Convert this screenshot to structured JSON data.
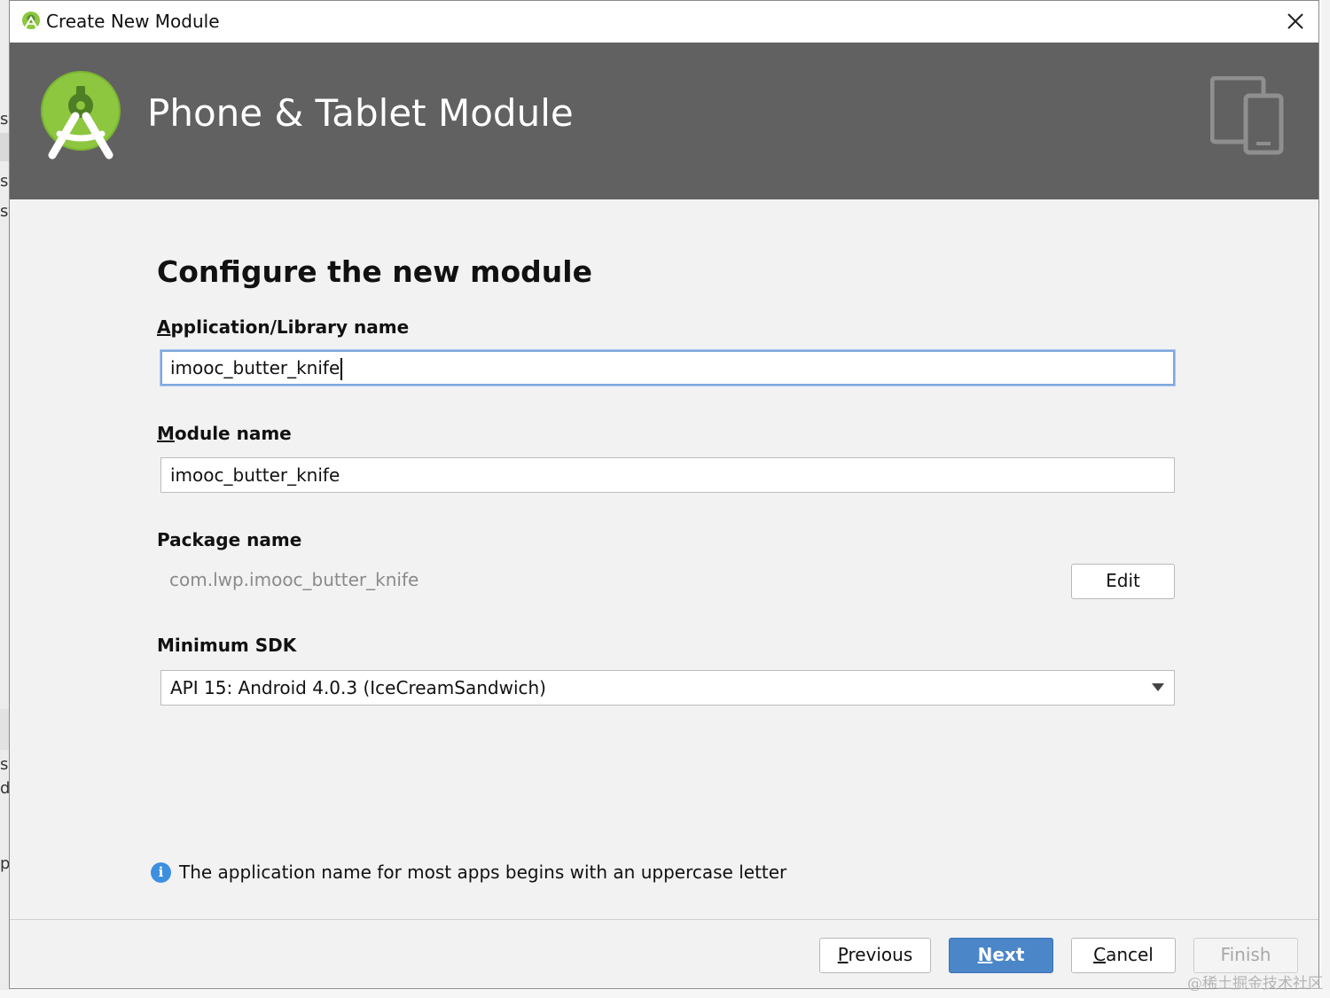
{
  "window": {
    "title": "Create New Module"
  },
  "background": {
    "left_glyphs": [
      "st",
      "st",
      "st",
      "s",
      "d",
      "p"
    ]
  },
  "banner": {
    "title": "Phone & Tablet Module"
  },
  "form": {
    "heading": "Configure the new module",
    "app_name": {
      "label_mnemonic": "A",
      "label_rest": "pplication/Library name",
      "value": "imooc_butter_knife"
    },
    "module_name": {
      "label_mnemonic": "M",
      "label_rest": "odule name",
      "value": "imooc_butter_knife"
    },
    "package_name": {
      "label": "Package name",
      "value": "com.lwp.imooc_butter_knife",
      "edit_label": "Edit"
    },
    "min_sdk": {
      "label": "Minimum SDK",
      "selected": "API 15: Android 4.0.3 (IceCreamSandwich)"
    }
  },
  "info": {
    "icon": "info-icon",
    "text": "The application name for most apps begins with an uppercase letter"
  },
  "footer": {
    "previous": {
      "mnemonic": "P",
      "rest": "revious"
    },
    "next": {
      "mnemonic": "N",
      "rest": "ext"
    },
    "cancel": {
      "mnemonic": "C",
      "rest": "ancel"
    },
    "finish": "Finish"
  },
  "watermark": "@稀土掘金技术社区",
  "colors": {
    "banner_bg": "#616161",
    "dialog_bg": "#f2f2f2",
    "primary_button": "#4a86c8",
    "android_green": "#8dc63f",
    "focus_border": "#7fa7dd",
    "info_blue": "#3d8fe0"
  }
}
